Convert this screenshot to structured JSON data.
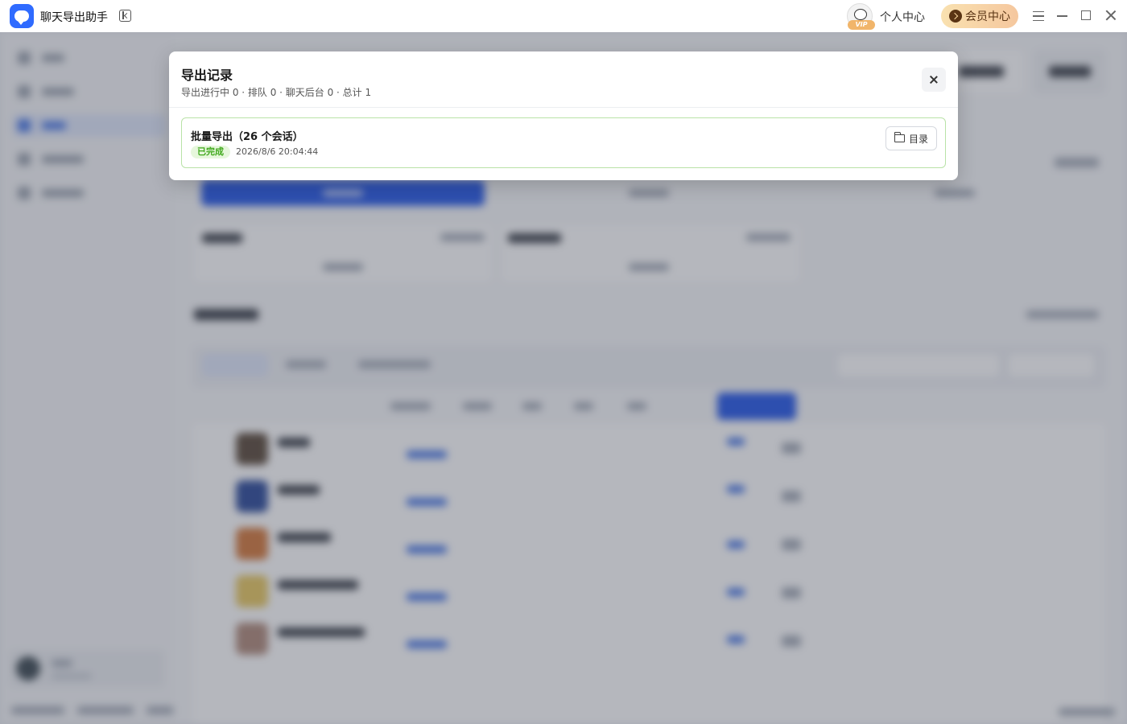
{
  "app": {
    "title": "聊天导出助手"
  },
  "titlebar": {
    "personal_center": "个人中心",
    "member_center": "会员中心",
    "vip_badge": "VIP"
  },
  "modal": {
    "title": "导出记录",
    "subtitle": "导出进行中 0 · 排队 0 · 聊天后台 0 · 总计 1",
    "records": [
      {
        "title": "批量导出（26 个会话）",
        "status": "已完成",
        "time": "2026/8/6 20:04:44",
        "action_label": "目录"
      }
    ]
  },
  "colors": {
    "accent": "#2f6bff",
    "success": "#3fa81b",
    "success_bg": "#e6f7dc",
    "member_gradient_start": "#f9e1b0",
    "member_gradient_end": "#f5c79e"
  }
}
